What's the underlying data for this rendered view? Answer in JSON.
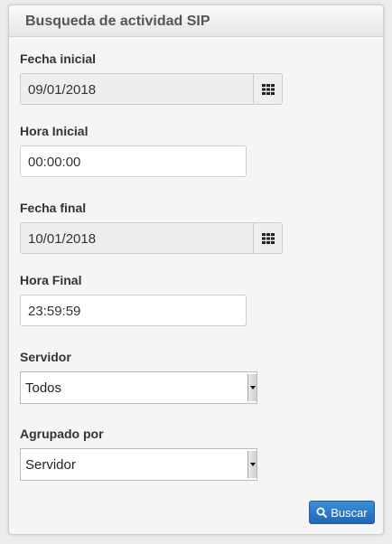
{
  "panel": {
    "title": "Busqueda de actividad SIP"
  },
  "form": {
    "fecha_inicial": {
      "label": "Fecha inicial",
      "value": "09/01/2018"
    },
    "hora_inicial": {
      "label": "Hora Inicial",
      "value": "00:00:00"
    },
    "fecha_final": {
      "label": "Fecha final",
      "value": "10/01/2018"
    },
    "hora_final": {
      "label": "Hora Final",
      "value": "23:59:59"
    },
    "servidor": {
      "label": "Servidor",
      "selected": "Todos"
    },
    "agrupado_por": {
      "label": "Agrupado por",
      "selected": "Servidor"
    }
  },
  "actions": {
    "search_label": "Buscar"
  },
  "icons": {
    "calendar": "calendar-grid-icon",
    "search": "search-icon"
  },
  "colors": {
    "primary_button": "#2a73c4"
  }
}
